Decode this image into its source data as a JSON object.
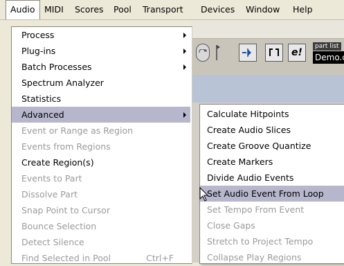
{
  "menubar": {
    "items": [
      "Audio",
      "MIDI",
      "Scores",
      "Pool",
      "Transport",
      "Devices",
      "Window",
      "Help"
    ],
    "active": "Audio"
  },
  "toolbar": {
    "part_list_label": "part list",
    "part_list_value": "Demo.c",
    "edit_button_label": "e!"
  },
  "audio_menu": {
    "items": [
      {
        "label": "Process",
        "submenu": true,
        "enabled": true
      },
      {
        "label": "Plug-ins",
        "submenu": true,
        "enabled": true
      },
      {
        "label": "Batch Processes",
        "submenu": true,
        "enabled": true
      },
      {
        "label": "Spectrum Analyzer",
        "enabled": true
      },
      {
        "label": "Statistics",
        "enabled": true
      },
      {
        "label": "Advanced",
        "submenu": true,
        "enabled": true,
        "highlighted": true
      },
      {
        "label": "Event or Range as Region",
        "enabled": false
      },
      {
        "label": "Events from Regions",
        "enabled": false
      },
      {
        "label": "Create Region(s)",
        "enabled": true
      },
      {
        "label": "Events to Part",
        "enabled": false
      },
      {
        "label": "Dissolve Part",
        "enabled": false
      },
      {
        "label": "Snap Point to Cursor",
        "enabled": false
      },
      {
        "label": "Bounce Selection",
        "enabled": false
      },
      {
        "label": "Detect Silence",
        "enabled": false
      },
      {
        "label": "Find Selected in Pool",
        "enabled": false,
        "shortcut": "Ctrl+F"
      }
    ]
  },
  "advanced_submenu": {
    "items": [
      {
        "label": "Calculate Hitpoints",
        "enabled": true
      },
      {
        "label": "Create Audio Slices",
        "enabled": true
      },
      {
        "label": "Create Groove Quantize",
        "enabled": true
      },
      {
        "label": "Create Markers",
        "enabled": true
      },
      {
        "label": "Divide Audio Events",
        "enabled": true
      },
      {
        "label": "Set Audio Event From Loop",
        "enabled": true,
        "highlighted": true
      },
      {
        "label": "Set Tempo From Event",
        "enabled": false
      },
      {
        "label": "Close Gaps",
        "enabled": false
      },
      {
        "label": "Stretch to Project Tempo",
        "enabled": false
      },
      {
        "label": "Collapse Play Regions",
        "enabled": false
      }
    ]
  },
  "colors": {
    "menu_highlight": "#b6b7cc",
    "disabled_text": "#9a9a9a",
    "chrome": "#ece9d8"
  }
}
